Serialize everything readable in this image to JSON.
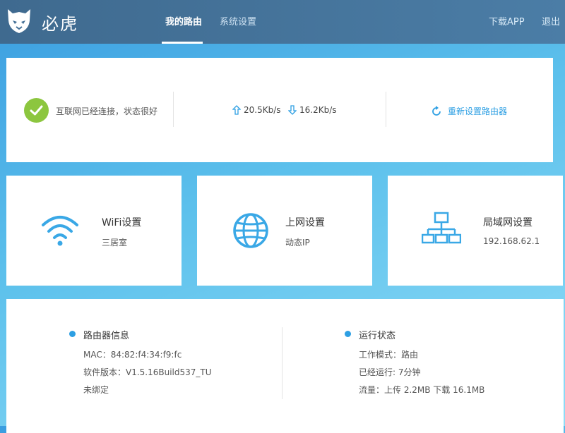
{
  "header": {
    "brand": "必虎",
    "tabs": [
      "我的路由",
      "系统设置"
    ],
    "links": {
      "download": "下载APP",
      "logout": "退出"
    }
  },
  "status": {
    "text": "互联网已经连接，状态很好",
    "upload": "20.5Kb/s",
    "download": "16.2Kb/s",
    "reset": "重新设置路由器"
  },
  "tiles": [
    {
      "title": "WiFi设置",
      "sub": "三居室",
      "icon": "wifi-icon"
    },
    {
      "title": "上网设置",
      "sub": "动态IP",
      "icon": "globe-icon"
    },
    {
      "title": "局域网设置",
      "sub": "192.168.62.1",
      "icon": "network-icon"
    }
  ],
  "router_info": {
    "title": "路由器信息",
    "lines": [
      "MAC：84:82:f4:34:f9:fc",
      "软件版本：V1.5.16Build537_TU",
      "未绑定"
    ]
  },
  "run_status": {
    "title": "运行状态",
    "lines": [
      "工作模式：路由",
      "已经运行: 7分钟",
      "流量：上传 2.2MB 下载 16.1MB"
    ]
  },
  "colors": {
    "accent": "#2d9fe3",
    "ok": "#8cc63f",
    "topbar": "#436f95"
  }
}
